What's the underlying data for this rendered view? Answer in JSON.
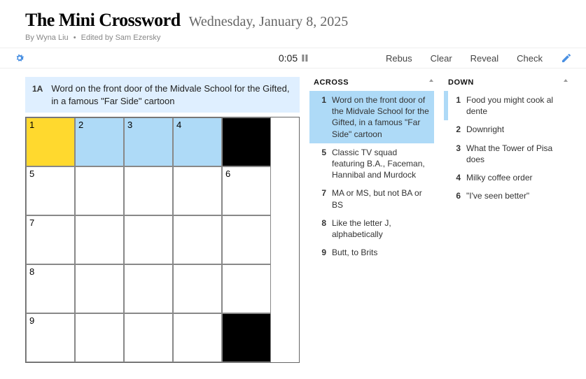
{
  "header": {
    "title": "The Mini Crossword",
    "date": "Wednesday, January 8, 2025",
    "byline_prefix": "By ",
    "author": "Wyna Liu",
    "sep": "•",
    "edited_prefix": "Edited by ",
    "editor": "Sam Ezersky"
  },
  "toolbar": {
    "timer": "0:05",
    "rebus": "Rebus",
    "clear": "Clear",
    "reveal": "Reveal",
    "check": "Check"
  },
  "current_clue": {
    "label": "1A",
    "text": "Word on the front door of the Midvale School for the Gifted, in a famous \"Far Side\" cartoon"
  },
  "grid": {
    "rows": [
      [
        {
          "n": "1",
          "s": "sel"
        },
        {
          "n": "2",
          "s": "hl"
        },
        {
          "n": "3",
          "s": "hl"
        },
        {
          "n": "4",
          "s": "hl"
        },
        {
          "s": "black"
        }
      ],
      [
        {
          "n": "5"
        },
        {},
        {},
        {},
        {
          "n": "6"
        }
      ],
      [
        {
          "n": "7"
        },
        {},
        {},
        {},
        {}
      ],
      [
        {
          "n": "8"
        },
        {},
        {},
        {},
        {}
      ],
      [
        {
          "n": "9"
        },
        {},
        {},
        {},
        {
          "s": "black"
        }
      ]
    ]
  },
  "across": {
    "heading": "ACROSS",
    "items": [
      {
        "n": "1",
        "t": "Word on the front door of the Midvale School for the Gifted, in a famous \"Far Side\" cartoon",
        "sel": true
      },
      {
        "n": "5",
        "t": "Classic TV squad featuring B.A., Faceman, Hannibal and Murdock"
      },
      {
        "n": "7",
        "t": "MA or MS, but not BA or BS"
      },
      {
        "n": "8",
        "t": "Like the letter J, alphabetically"
      },
      {
        "n": "9",
        "t": "Butt, to Brits"
      }
    ]
  },
  "down": {
    "heading": "DOWN",
    "items": [
      {
        "n": "1",
        "t": "Food you might cook al dente",
        "cross": true
      },
      {
        "n": "2",
        "t": "Downright"
      },
      {
        "n": "3",
        "t": "What the Tower of Pisa does"
      },
      {
        "n": "4",
        "t": "Milky coffee order"
      },
      {
        "n": "6",
        "t": "\"I've seen better\""
      }
    ]
  }
}
